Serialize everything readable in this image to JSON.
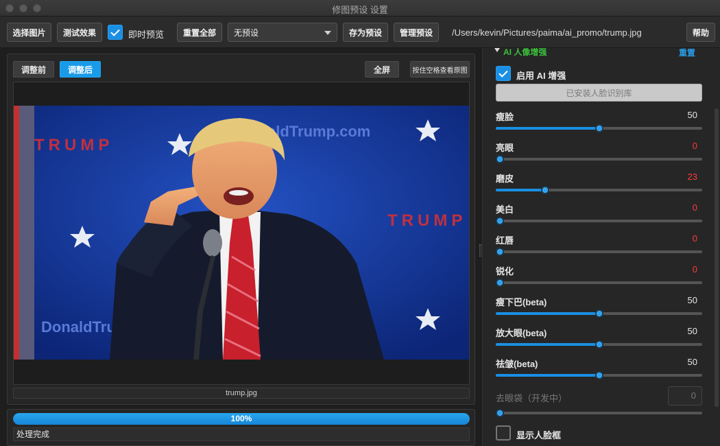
{
  "window": {
    "title": "修图预设 设置"
  },
  "toolbar": {
    "select_image": "选择图片",
    "test_effect": "测试效果",
    "live_preview_label": "即时预览",
    "live_preview_checked": true,
    "reset_all": "重置全部",
    "preset_value": "无预设",
    "save_preset": "存为预设",
    "manage_preset": "管理预设",
    "path": "/Users/kevin/Pictures/paima/ai_promo/trump.jpg",
    "help": "帮助"
  },
  "preview": {
    "before": "调整前",
    "after": "调整后",
    "fullscreen": "全屏",
    "hold_space": "按住空格查看原图",
    "filename": "trump.jpg",
    "image_alt": "photo"
  },
  "progress": {
    "percent": 100,
    "percent_label": "100%",
    "status": "处理完成"
  },
  "ai_panel": {
    "section_title": "AI 人像增强",
    "reset": "重置",
    "enable_label": "启用 AI 增强",
    "enable_checked": true,
    "face_lib_button": "已安装人脸识别库",
    "sliders": [
      {
        "key": "slim-face",
        "label": "瘦脸",
        "value": "50",
        "fraction": 0.5,
        "value_color": "#e6e6e6"
      },
      {
        "key": "brighten-eyes",
        "label": "亮眼",
        "value": "0",
        "fraction": 0.0,
        "value_color": "#ff3b3b"
      },
      {
        "key": "smooth-skin",
        "label": "磨皮",
        "value": "23",
        "fraction": 0.23,
        "value_color": "#ff3b3b"
      },
      {
        "key": "whiten",
        "label": "美白",
        "value": "0",
        "fraction": 0.0,
        "value_color": "#ff3b3b"
      },
      {
        "key": "red-lips",
        "label": "红唇",
        "value": "0",
        "fraction": 0.0,
        "value_color": "#ff3b3b"
      },
      {
        "key": "sharpen",
        "label": "锐化",
        "value": "0",
        "fraction": 0.0,
        "value_color": "#ff3b3b"
      },
      {
        "key": "slim-chin",
        "label": "瘦下巴(beta)",
        "value": "50",
        "fraction": 0.5,
        "value_color": "#e6e6e6"
      },
      {
        "key": "enlarge-eyes",
        "label": "放大眼(beta)",
        "value": "50",
        "fraction": 0.5,
        "value_color": "#e6e6e6"
      },
      {
        "key": "remove-wrinkles",
        "label": "祛皱(beta)",
        "value": "50",
        "fraction": 0.5,
        "value_color": "#e6e6e6"
      }
    ],
    "eye_bags": {
      "label": "去眼袋（开发中）",
      "value": "0",
      "fraction": 0.0
    },
    "show_face_box_label": "显示人脸框",
    "show_face_box_checked": false
  },
  "colors": {
    "accent": "#1a8fe3",
    "warning": "#ff3b3b",
    "success": "#3bc23b"
  }
}
